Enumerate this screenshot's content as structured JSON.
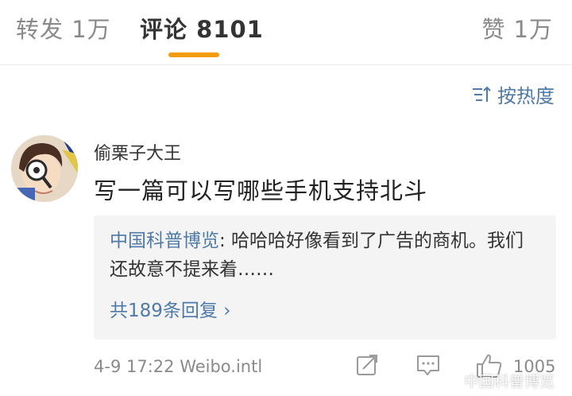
{
  "tabs": {
    "repost": "转发 1万",
    "comments": "评论 8101",
    "likes": "赞 1万"
  },
  "sort": {
    "label": "按热度"
  },
  "comment": {
    "username": "偷栗子大王",
    "text": "写一篇可以写哪些手机支持北斗",
    "reply": {
      "author": "中国科普博览",
      "text": ": 哈哈哈好像看到了广告的商机。我们还故意不提来着……",
      "more": "共189条回复 ›"
    },
    "time": "4-9 17:22",
    "source": "Weibo.intl",
    "likes": "1005"
  },
  "watermark": "中国科普博览",
  "colors": {
    "accent": "#f39c12",
    "link": "#4f7aa8",
    "gray": "#8a8a8a"
  }
}
